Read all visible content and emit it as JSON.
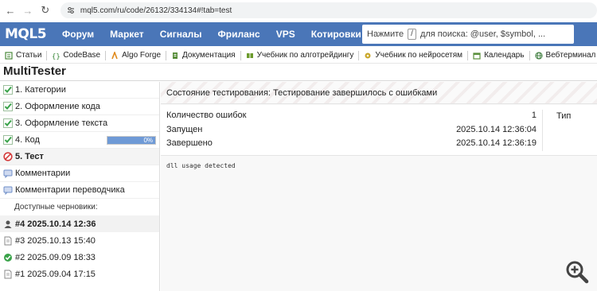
{
  "browser": {
    "url": "mql5.com/ru/code/26132/334134#!tab=test"
  },
  "nav": {
    "logo": "MQL5",
    "items": [
      "Форум",
      "Маркет",
      "Сигналы",
      "Фриланс",
      "VPS",
      "Котировки"
    ],
    "search_prefix": "Нажмите",
    "search_key": "/",
    "search_suffix": "для поиска: @user, $symbol, ..."
  },
  "bookmarks": [
    {
      "label": "Статьи",
      "icon": "articles-icon"
    },
    {
      "label": "CodeBase",
      "icon": "codebase-icon"
    },
    {
      "label": "Algo Forge",
      "icon": "algoforge-icon"
    },
    {
      "label": "Документация",
      "icon": "docs-icon"
    },
    {
      "label": "Учебник по алготрейдингу",
      "icon": "book-icon"
    },
    {
      "label": "Учебник по нейросетям",
      "icon": "neural-icon"
    },
    {
      "label": "Календарь",
      "icon": "calendar-icon"
    },
    {
      "label": "Вебтерминал",
      "icon": "globe-icon"
    }
  ],
  "page_title": "MultiTester",
  "sidebar": {
    "steps": [
      {
        "label": "1. Категории",
        "status": "done"
      },
      {
        "label": "2. Оформление кода",
        "status": "done"
      },
      {
        "label": "3. Оформление текста",
        "status": "done"
      },
      {
        "label": "4. Код",
        "status": "done",
        "progress": 1.0,
        "progress_text": "0%"
      },
      {
        "label": "5. Тест",
        "status": "error"
      }
    ],
    "comments": [
      {
        "label": "Комментарии"
      },
      {
        "label": "Комментарии переводчика"
      }
    ],
    "drafts_label": "Доступные черновики:",
    "drafts": [
      {
        "label": "#4 2025.10.14 12:36",
        "icon": "user-icon"
      },
      {
        "label": "#3 2025.10.13 15:40",
        "icon": "document-icon"
      },
      {
        "label": "#2 2025.09.09 18:33",
        "icon": "check-icon"
      },
      {
        "label": "#1 2025.09.04 17:15",
        "icon": "document-icon"
      }
    ]
  },
  "test": {
    "status": "Состояние тестирования: Тестирование завершилось с ошибками",
    "rows": [
      {
        "label": "Количество ошибок",
        "value": "1"
      },
      {
        "label": "Запущен",
        "value": "2025.10.14 12:36:04"
      },
      {
        "label": "Завершено",
        "value": "2025.10.14 12:36:19"
      }
    ],
    "type_header": "Тип",
    "log": "dll usage detected"
  },
  "colors": {
    "nav_bg": "#4a76b8",
    "check_green": "#3aa34a",
    "error_red": "#d43a3a",
    "progress_fill": "#6f9ad6"
  }
}
